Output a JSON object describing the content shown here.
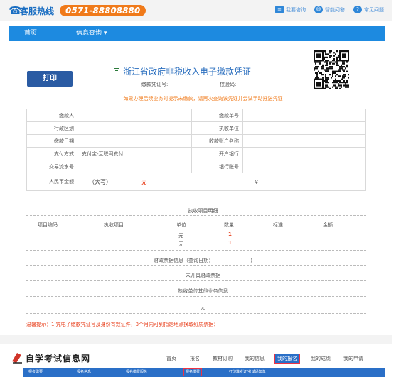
{
  "topbar": {
    "hotline_label": "客服热线",
    "hotline_number": "0571-88808880",
    "links": [
      {
        "label": "我要咨询",
        "icon": "chat-icon"
      },
      {
        "label": "智能问答",
        "icon": "robot-icon"
      },
      {
        "label": "常见问题",
        "icon": "question-icon"
      }
    ]
  },
  "nav": {
    "home": "首页",
    "info_query": "信息查询 ▾"
  },
  "doc": {
    "print_label": "打印",
    "title": "浙江省政府非税收入电子缴款凭证",
    "voucher_no_label": "缴款凭证号:",
    "check_code_label": "校验码:",
    "notice": "如果办理后续业务时提示未缴款，请再次查询该凭证并尝试手动推送凭证"
  },
  "table": {
    "payer": "缴款人",
    "payment_no": "缴款单号",
    "region": "行政区划",
    "collector": "执收单位",
    "pay_date": "缴款日期",
    "account_name": "收款账户名称",
    "pay_method": "支付方式",
    "pay_method_value": "支付宝-互联网支付",
    "bank": "开户银行",
    "txn_no": "交易流水号",
    "bank_account": "银行账号",
    "amount": "人民币金额",
    "amount_upper": "（大写）",
    "amount_unit": "元",
    "amount_symbol": "¥"
  },
  "items": {
    "section_title": "执收项目明细",
    "columns": [
      "项目编码",
      "执收项目",
      "单位",
      "数量",
      "标准",
      "金额"
    ],
    "rows": [
      {
        "unit": "元",
        "qty": "1"
      },
      {
        "unit": "元",
        "qty": "1"
      }
    ]
  },
  "sections": {
    "finance_bill": "财政票据信息（查询日期：",
    "finance_bill_end": ")",
    "no_bill": "未开具财政票据",
    "other_info": "执收单位其他业务信息",
    "none": "无"
  },
  "warning": "温馨提示：1.凭电子缴款凭证号及身份有效证件，3个月内可到指定地点换取纸质票据；",
  "site": {
    "logo_text": "自学考试信息网",
    "nav": [
      "首页",
      "报名",
      "教材订购",
      "我的信息",
      "我的报名",
      "我的成绩",
      "我的申请"
    ],
    "subnav": [
      "报考需要",
      "报名信息",
      "报名缴费服务",
      "报名缴费",
      "打印准考证/考试通知单"
    ]
  },
  "colors": {
    "accent": "#1d8ae0",
    "hotline": "#f07a1a",
    "warn": "#e8411e"
  }
}
